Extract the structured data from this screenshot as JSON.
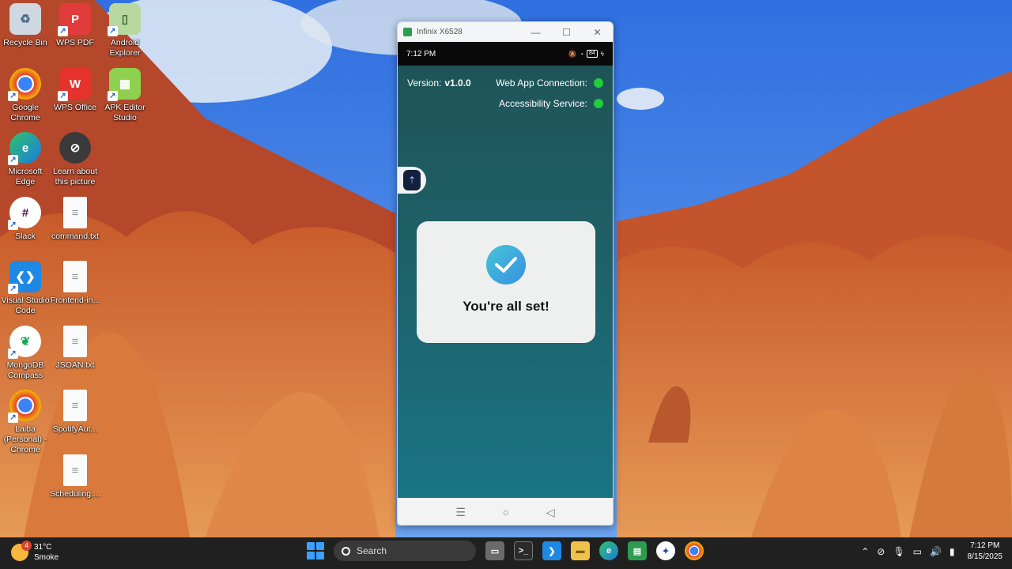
{
  "desktop": {
    "icons": [
      {
        "label": "Recycle Bin",
        "icon": "recycle-bin-icon"
      },
      {
        "label": "WPS PDF",
        "icon": "wps-pdf-icon"
      },
      {
        "label": "Android Explorer",
        "icon": "android-explorer-icon"
      },
      {
        "label": "Google Chrome",
        "icon": "chrome-icon"
      },
      {
        "label": "WPS Office",
        "icon": "wps-office-icon"
      },
      {
        "label": "APK Editor Studio",
        "icon": "apk-editor-icon"
      },
      {
        "label": "Microsoft Edge",
        "icon": "edge-icon"
      },
      {
        "label": "Learn about this picture",
        "icon": "learn-picture-icon"
      },
      {
        "label": "Slack",
        "icon": "slack-icon"
      },
      {
        "label": "command.txt",
        "icon": "text-file-icon"
      },
      {
        "label": "Visual Studio Code",
        "icon": "vscode-icon"
      },
      {
        "label": "Frontend-in...",
        "icon": "text-file-icon"
      },
      {
        "label": "MongoDB Compass",
        "icon": "mongodb-icon"
      },
      {
        "label": "JSOAN.txt",
        "icon": "text-file-icon"
      },
      {
        "label": "Laiba (Personal) - Chrome",
        "icon": "chrome-profile-icon"
      },
      {
        "label": "SpotifyAut...",
        "icon": "text-file-icon"
      },
      {
        "label": "Scheduling....",
        "icon": "text-file-icon"
      }
    ]
  },
  "phone_window": {
    "title": "Infinix X6528",
    "status": {
      "time": "7:12 PM",
      "battery": "84"
    },
    "version_label": "Version:",
    "version_value": "v1.0.0",
    "web_app_label": "Web App Connection:",
    "accessibility_label": "Accessibility Service:",
    "status_color": "#22cc3a",
    "card_message": "You're all set!"
  },
  "taskbar": {
    "weather_temp": "31°C",
    "weather_desc": "Smoke",
    "weather_badge": "4",
    "search_placeholder": "Search",
    "time": "7:12 PM",
    "date": "8/15/2025"
  }
}
